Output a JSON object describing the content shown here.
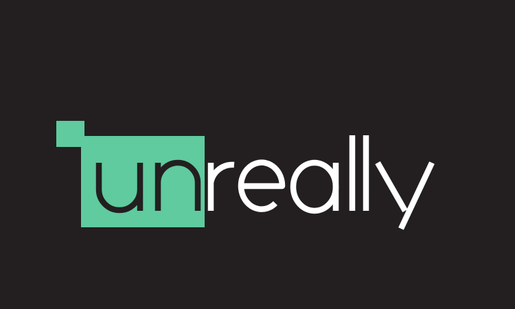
{
  "logo": {
    "wordmark": "unreally",
    "part_on_block": "un",
    "part_off_block": "really"
  },
  "colors": {
    "background": "#231f20",
    "accent": "#5fcb9e",
    "dark_text": "#231f20",
    "light_text": "#ffffff"
  },
  "icon": "unreally-logo"
}
